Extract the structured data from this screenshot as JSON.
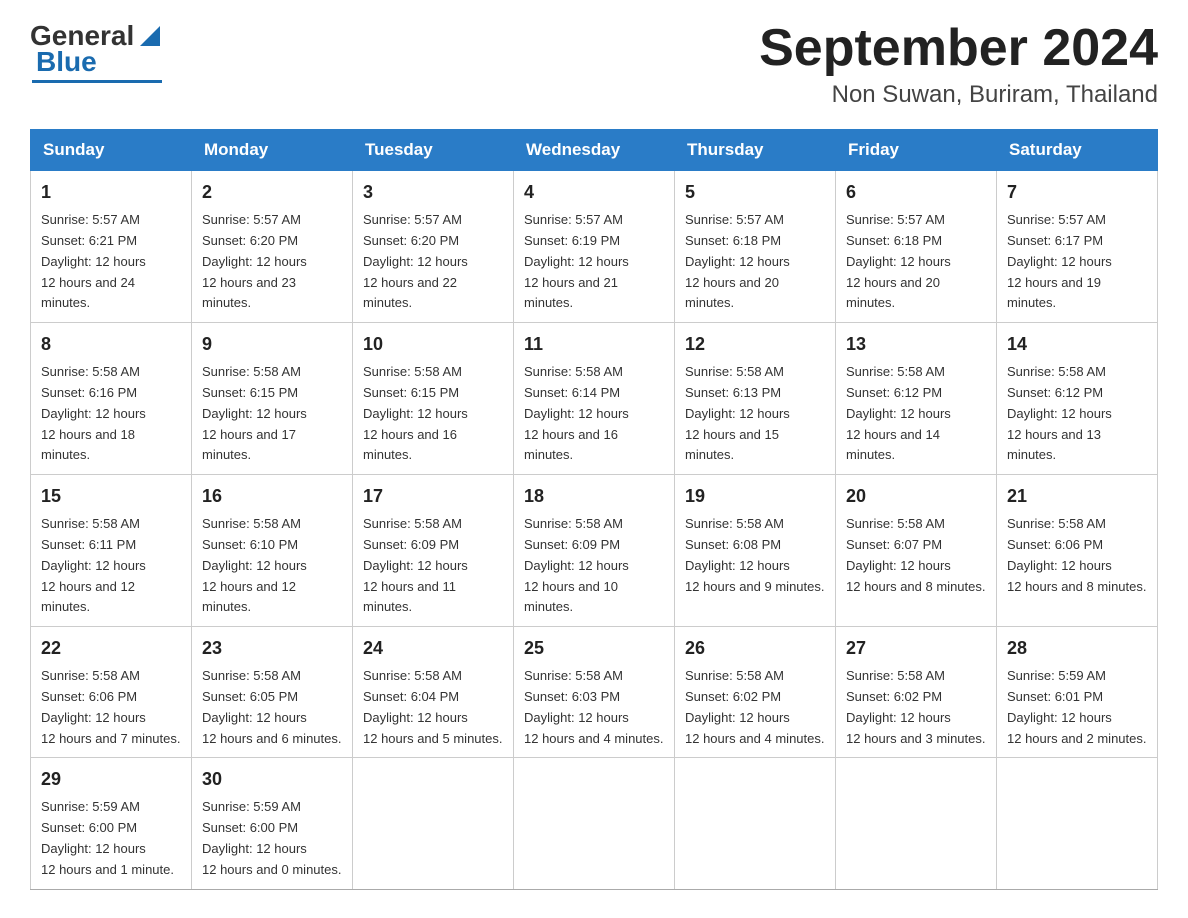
{
  "header": {
    "logo": {
      "general": "General",
      "blue": "Blue"
    },
    "title": "September 2024",
    "location": "Non Suwan, Buriram, Thailand"
  },
  "days_of_week": [
    "Sunday",
    "Monday",
    "Tuesday",
    "Wednesday",
    "Thursday",
    "Friday",
    "Saturday"
  ],
  "weeks": [
    [
      {
        "day": "1",
        "sunrise": "5:57 AM",
        "sunset": "6:21 PM",
        "daylight": "12 hours and 24 minutes."
      },
      {
        "day": "2",
        "sunrise": "5:57 AM",
        "sunset": "6:20 PM",
        "daylight": "12 hours and 23 minutes."
      },
      {
        "day": "3",
        "sunrise": "5:57 AM",
        "sunset": "6:20 PM",
        "daylight": "12 hours and 22 minutes."
      },
      {
        "day": "4",
        "sunrise": "5:57 AM",
        "sunset": "6:19 PM",
        "daylight": "12 hours and 21 minutes."
      },
      {
        "day": "5",
        "sunrise": "5:57 AM",
        "sunset": "6:18 PM",
        "daylight": "12 hours and 20 minutes."
      },
      {
        "day": "6",
        "sunrise": "5:57 AM",
        "sunset": "6:18 PM",
        "daylight": "12 hours and 20 minutes."
      },
      {
        "day": "7",
        "sunrise": "5:57 AM",
        "sunset": "6:17 PM",
        "daylight": "12 hours and 19 minutes."
      }
    ],
    [
      {
        "day": "8",
        "sunrise": "5:58 AM",
        "sunset": "6:16 PM",
        "daylight": "12 hours and 18 minutes."
      },
      {
        "day": "9",
        "sunrise": "5:58 AM",
        "sunset": "6:15 PM",
        "daylight": "12 hours and 17 minutes."
      },
      {
        "day": "10",
        "sunrise": "5:58 AM",
        "sunset": "6:15 PM",
        "daylight": "12 hours and 16 minutes."
      },
      {
        "day": "11",
        "sunrise": "5:58 AM",
        "sunset": "6:14 PM",
        "daylight": "12 hours and 16 minutes."
      },
      {
        "day": "12",
        "sunrise": "5:58 AM",
        "sunset": "6:13 PM",
        "daylight": "12 hours and 15 minutes."
      },
      {
        "day": "13",
        "sunrise": "5:58 AM",
        "sunset": "6:12 PM",
        "daylight": "12 hours and 14 minutes."
      },
      {
        "day": "14",
        "sunrise": "5:58 AM",
        "sunset": "6:12 PM",
        "daylight": "12 hours and 13 minutes."
      }
    ],
    [
      {
        "day": "15",
        "sunrise": "5:58 AM",
        "sunset": "6:11 PM",
        "daylight": "12 hours and 12 minutes."
      },
      {
        "day": "16",
        "sunrise": "5:58 AM",
        "sunset": "6:10 PM",
        "daylight": "12 hours and 12 minutes."
      },
      {
        "day": "17",
        "sunrise": "5:58 AM",
        "sunset": "6:09 PM",
        "daylight": "12 hours and 11 minutes."
      },
      {
        "day": "18",
        "sunrise": "5:58 AM",
        "sunset": "6:09 PM",
        "daylight": "12 hours and 10 minutes."
      },
      {
        "day": "19",
        "sunrise": "5:58 AM",
        "sunset": "6:08 PM",
        "daylight": "12 hours and 9 minutes."
      },
      {
        "day": "20",
        "sunrise": "5:58 AM",
        "sunset": "6:07 PM",
        "daylight": "12 hours and 8 minutes."
      },
      {
        "day": "21",
        "sunrise": "5:58 AM",
        "sunset": "6:06 PM",
        "daylight": "12 hours and 8 minutes."
      }
    ],
    [
      {
        "day": "22",
        "sunrise": "5:58 AM",
        "sunset": "6:06 PM",
        "daylight": "12 hours and 7 minutes."
      },
      {
        "day": "23",
        "sunrise": "5:58 AM",
        "sunset": "6:05 PM",
        "daylight": "12 hours and 6 minutes."
      },
      {
        "day": "24",
        "sunrise": "5:58 AM",
        "sunset": "6:04 PM",
        "daylight": "12 hours and 5 minutes."
      },
      {
        "day": "25",
        "sunrise": "5:58 AM",
        "sunset": "6:03 PM",
        "daylight": "12 hours and 4 minutes."
      },
      {
        "day": "26",
        "sunrise": "5:58 AM",
        "sunset": "6:02 PM",
        "daylight": "12 hours and 4 minutes."
      },
      {
        "day": "27",
        "sunrise": "5:58 AM",
        "sunset": "6:02 PM",
        "daylight": "12 hours and 3 minutes."
      },
      {
        "day": "28",
        "sunrise": "5:59 AM",
        "sunset": "6:01 PM",
        "daylight": "12 hours and 2 minutes."
      }
    ],
    [
      {
        "day": "29",
        "sunrise": "5:59 AM",
        "sunset": "6:00 PM",
        "daylight": "12 hours and 1 minute."
      },
      {
        "day": "30",
        "sunrise": "5:59 AM",
        "sunset": "6:00 PM",
        "daylight": "12 hours and 0 minutes."
      },
      null,
      null,
      null,
      null,
      null
    ]
  ]
}
